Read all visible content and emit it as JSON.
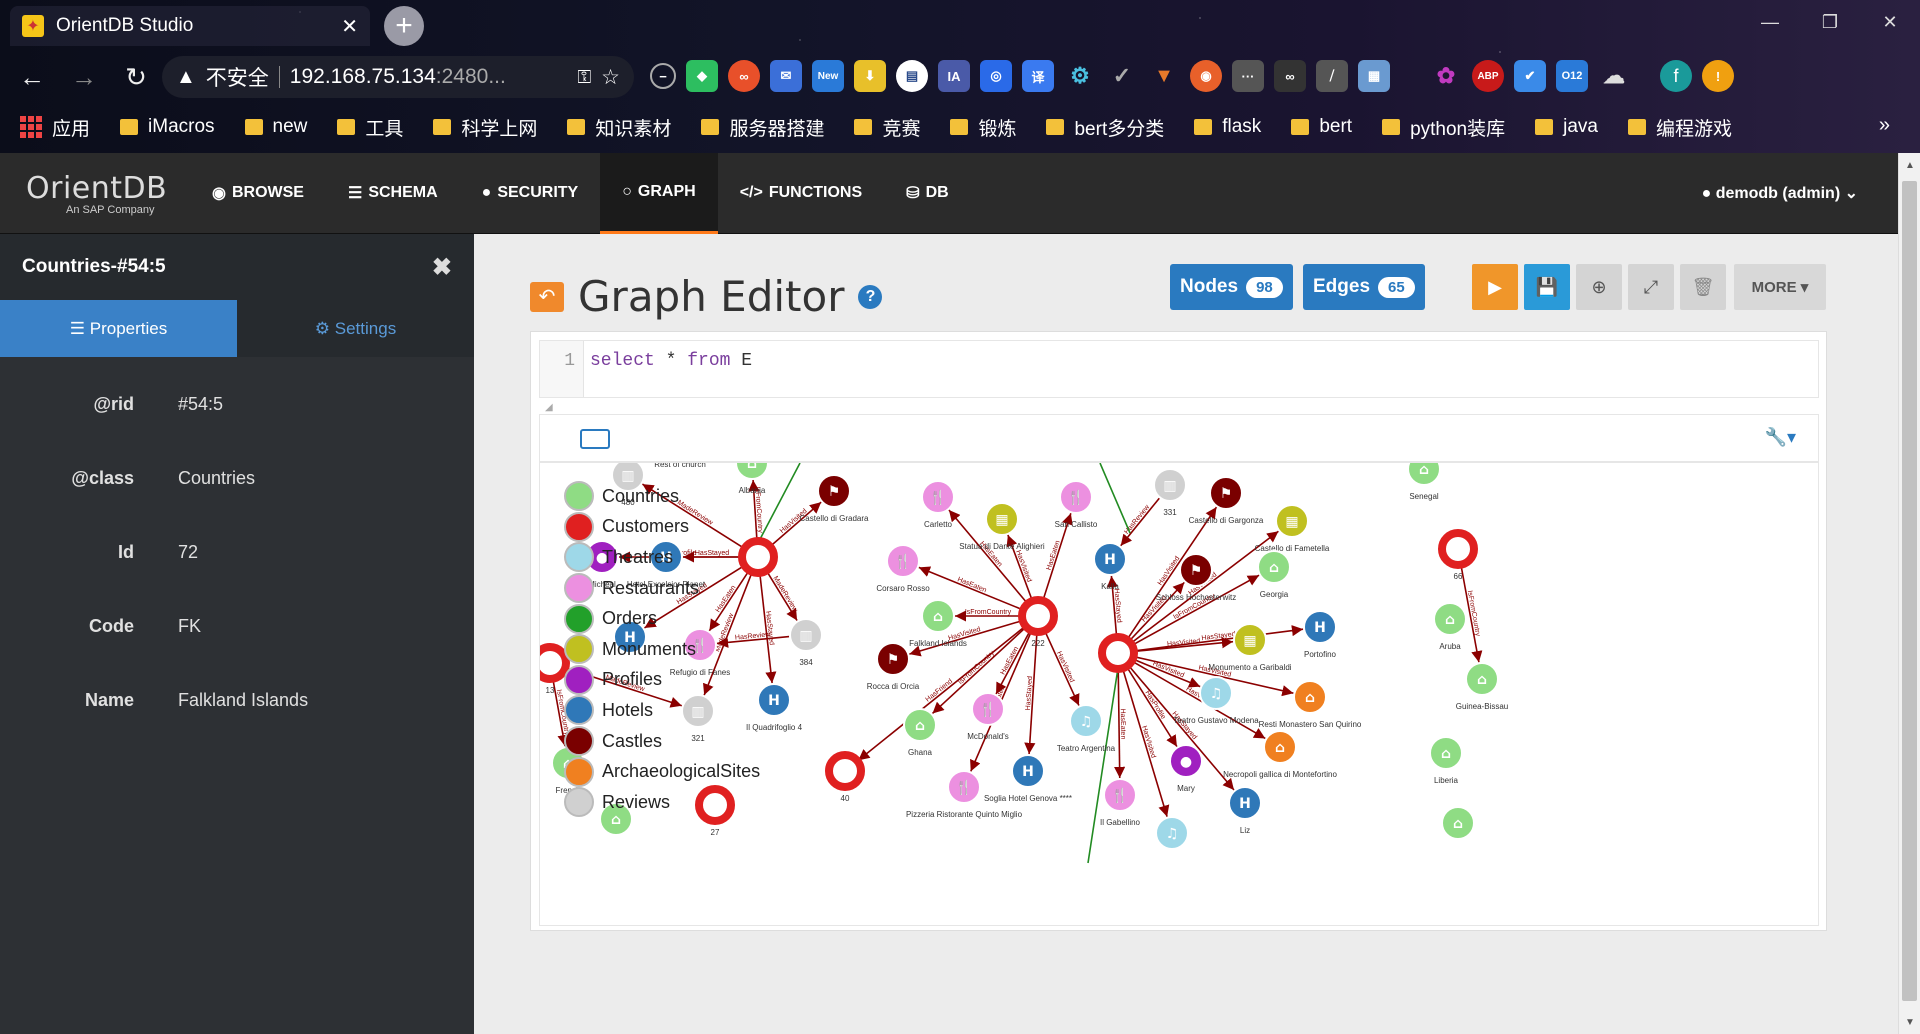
{
  "browser": {
    "tab_title": "OrientDB Studio",
    "address_warning": "不安全",
    "address_host": "192.168.75.134",
    "address_port": ":2480...",
    "extensions": [
      "minus-circle-icon",
      "evernote-icon",
      "infinity-icon",
      "mail-icon",
      "new-badge-icon",
      "pin-icon",
      "reader-icon",
      "ia-icon",
      "baidu-icon",
      "translate-icon",
      "gear-icon",
      "check-icon",
      "fox-icon",
      "target-icon",
      "dots-icon",
      "glasses-icon",
      "slash-icon",
      "image-icon",
      "candy-icon",
      "abp-icon",
      "check-badge-icon",
      "o12-icon",
      "cloud-icon",
      "profile-icon",
      "alert-icon"
    ],
    "ext_new_label": "New",
    "ext_ia_label": "IA",
    "ext_abp_label": "ABP",
    "ext_o12_label": "O12",
    "profile_letter": "f",
    "bookmarks": [
      "应用",
      "iMacros",
      "new",
      "工具",
      "科学上网",
      "知识素材",
      "服务器搭建",
      "竞赛",
      "锻炼",
      "bert多分类",
      "flask",
      "bert",
      "python装库",
      "java",
      "编程游戏"
    ]
  },
  "app": {
    "logo_name": "OrientDB",
    "logo_sub": "An SAP Company",
    "nav": [
      "BROWSE",
      "SCHEMA",
      "SECURITY",
      "GRAPH",
      "FUNCTIONS",
      "DB"
    ],
    "active_nav": "GRAPH",
    "user": "demodb (admin)"
  },
  "sidebar": {
    "title": "Countries-#54:5",
    "tab_properties": "Properties",
    "tab_settings": "Settings",
    "properties": [
      {
        "key": "@rid",
        "value": "#54:5"
      },
      {
        "key": "@class",
        "value": "Countries"
      },
      {
        "key": "Id",
        "value": "72"
      },
      {
        "key": "Code",
        "value": "FK"
      },
      {
        "key": "Name",
        "value": "Falkland Islands"
      }
    ]
  },
  "editor": {
    "title": "Graph Editor",
    "nodes_label": "Nodes",
    "nodes_count": "98",
    "edges_label": "Edges",
    "edges_count": "65",
    "more_label": "MORE",
    "line_number": "1",
    "query_kw1": "select",
    "query_star": "*",
    "query_kw2": "from",
    "query_cls": "E"
  },
  "legend": [
    {
      "label": "Countries",
      "color": "#8fdc84"
    },
    {
      "label": "Customers",
      "color": "#e02020"
    },
    {
      "label": "Theatres",
      "color": "#9ed8e8"
    },
    {
      "label": "Restaurants",
      "color": "#ec90e0"
    },
    {
      "label": "Orders",
      "color": "#22a02a"
    },
    {
      "label": "Monuments",
      "color": "#c0c020"
    },
    {
      "label": "Profiles",
      "color": "#a020c0"
    },
    {
      "label": "Hotels",
      "color": "#2f78b8"
    },
    {
      "label": "Castles",
      "color": "#7a0000"
    },
    {
      "label": "ArchaeologicalSites",
      "color": "#f08020"
    },
    {
      "label": "Reviews",
      "color": "#d0d0d0"
    }
  ],
  "graph_nodes": [
    {
      "id": "n1",
      "label": "",
      "cls": "Customers"
    },
    {
      "id": "n2",
      "label": "222",
      "cls": "Customers"
    },
    {
      "id": "n3",
      "label": "",
      "cls": "Customers"
    },
    {
      "id": "n4",
      "label": "66",
      "cls": "Customers"
    },
    {
      "id": "n5",
      "label": "40",
      "cls": "Customers"
    },
    {
      "id": "n6",
      "label": "27",
      "cls": "Customers"
    },
    {
      "id": "n7",
      "label": "13",
      "cls": "Customers"
    },
    {
      "id": "h1",
      "label": "Hotel Excelsior Planet",
      "cls": "Hotels"
    },
    {
      "id": "h2",
      "label": "Il Quadrifoglio 4",
      "cls": "Hotels"
    },
    {
      "id": "h3",
      "label": "Soglia Hotel Genova ****",
      "cls": "Hotels"
    },
    {
      "id": "h4",
      "label": "Kalla",
      "cls": "Hotels"
    },
    {
      "id": "h5",
      "label": "Portofino",
      "cls": "Hotels"
    },
    {
      "id": "h6",
      "label": "Liz",
      "cls": "Hotels"
    },
    {
      "id": "h7",
      "label": "",
      "cls": "Hotels"
    },
    {
      "id": "r1",
      "label": "Carletto",
      "cls": "Restaurants"
    },
    {
      "id": "r2",
      "label": "Corsaro Rosso",
      "cls": "Restaurants"
    },
    {
      "id": "r3",
      "label": "Refugio di Fanes",
      "cls": "Restaurants"
    },
    {
      "id": "r4",
      "label": "McDonald's",
      "cls": "Restaurants"
    },
    {
      "id": "r5",
      "label": "Pizzeria Ristorante Quinto Miglio",
      "cls": "Restaurants"
    },
    {
      "id": "r6",
      "label": "San Callisto",
      "cls": "Restaurants"
    },
    {
      "id": "r7",
      "label": "Il Gabellino",
      "cls": "Restaurants"
    },
    {
      "id": "c1",
      "label": "Castello di Gradara",
      "cls": "Castles"
    },
    {
      "id": "c2",
      "label": "Rocca di Orcia",
      "cls": "Castles"
    },
    {
      "id": "c3",
      "label": "Castello di Gargonza",
      "cls": "Castles"
    },
    {
      "id": "c4",
      "label": "Schloss Hochosterwitz",
      "cls": "Castles"
    },
    {
      "id": "m1",
      "label": "Statua di Dante Alighieri",
      "cls": "Monuments"
    },
    {
      "id": "m2",
      "label": "Castello di Fametella",
      "cls": "Monuments"
    },
    {
      "id": "m3",
      "label": "Monumento a Garibaldi",
      "cls": "Monuments"
    },
    {
      "id": "v1",
      "label": "480",
      "cls": "Reviews"
    },
    {
      "id": "v2",
      "label": "384",
      "cls": "Reviews"
    },
    {
      "id": "v3",
      "label": "321",
      "cls": "Reviews"
    },
    {
      "id": "v4",
      "label": "331",
      "cls": "Reviews"
    },
    {
      "id": "co1",
      "label": "Falkland Islands",
      "cls": "Countries"
    },
    {
      "id": "co2",
      "label": "Ghana",
      "cls": "Countries"
    },
    {
      "id": "co3",
      "label": "Georgia",
      "cls": "Countries"
    },
    {
      "id": "co4",
      "label": "Senegal",
      "cls": "Countries"
    },
    {
      "id": "co5",
      "label": "Aruba",
      "cls": "Countries"
    },
    {
      "id": "co6",
      "label": "Guinea-Bissau",
      "cls": "Countries"
    },
    {
      "id": "co7",
      "label": "Liberia",
      "cls": "Countries"
    },
    {
      "id": "co8",
      "label": "French",
      "cls": "Countries"
    },
    {
      "id": "co9",
      "label": "Albania",
      "cls": "Countries"
    },
    {
      "id": "co10",
      "label": "",
      "cls": "Countries"
    },
    {
      "id": "co11",
      "label": "",
      "cls": "Countries"
    },
    {
      "id": "t1",
      "label": "Teatro Argentina",
      "cls": "Theatres"
    },
    {
      "id": "t2",
      "label": "Teatro Gustavo Modena",
      "cls": "Theatres"
    },
    {
      "id": "t3",
      "label": "",
      "cls": "Theatres"
    },
    {
      "id": "a1",
      "label": "Resti Monastero San Quirino",
      "cls": "ArchaeologicalSites"
    },
    {
      "id": "a2",
      "label": "Necropoli gallica di Montefortino",
      "cls": "ArchaeologicalSites"
    },
    {
      "id": "p1",
      "label": "Micheal",
      "cls": "Profiles"
    },
    {
      "id": "p2",
      "label": "Mary",
      "cls": "Profiles"
    },
    {
      "id": "x1",
      "label": "Rest of church",
      "cls": "Other"
    }
  ],
  "graph_edges": [
    {
      "from": "n1",
      "to": "c1",
      "label": "HasVisited"
    },
    {
      "from": "n1",
      "to": "h1",
      "label": "HasStayed"
    },
    {
      "from": "n1",
      "to": "v1",
      "label": "MadeReview"
    },
    {
      "from": "n1",
      "to": "r3",
      "label": "HasEaten"
    },
    {
      "from": "n1",
      "to": "h2",
      "label": "HasStayed"
    },
    {
      "from": "n1",
      "to": "v2",
      "label": "MadeReview"
    },
    {
      "from": "n1",
      "to": "h7",
      "label": "HasStayed"
    },
    {
      "from": "n1",
      "to": "p1",
      "label": "HasProfile"
    },
    {
      "from": "n1",
      "to": "co9",
      "label": "IsFromCountry"
    },
    {
      "from": "n1",
      "to": "v3",
      "label": "MadeReview"
    },
    {
      "from": "n2",
      "to": "r1",
      "label": "HasEaten"
    },
    {
      "from": "n2",
      "to": "m1",
      "label": "HasVisited"
    },
    {
      "from": "n2",
      "to": "r6",
      "label": "HasEaten"
    },
    {
      "from": "n2",
      "to": "r2",
      "label": "HasEaten"
    },
    {
      "from": "n2",
      "to": "co1",
      "label": "IsFromCountry"
    },
    {
      "from": "n2",
      "to": "c2",
      "label": "HasVisited"
    },
    {
      "from": "n2",
      "to": "r4",
      "label": "HasEaten"
    },
    {
      "from": "n2",
      "to": "h3",
      "label": "HasStayed"
    },
    {
      "from": "n2",
      "to": "t1",
      "label": "HasVisited"
    },
    {
      "from": "n2",
      "to": "r5",
      "label": "HasEaten"
    },
    {
      "from": "n2",
      "to": "co2",
      "label": "IsFromCountry"
    },
    {
      "from": "n2",
      "to": "n5",
      "label": "HasFriend"
    },
    {
      "from": "n3",
      "to": "h4",
      "label": "HasStayed"
    },
    {
      "from": "n3",
      "to": "c3",
      "label": "HasVisited"
    },
    {
      "from": "n3",
      "to": "m2",
      "label": "HasVisited"
    },
    {
      "from": "n3",
      "to": "c4",
      "label": "HasVisited"
    },
    {
      "from": "n3",
      "to": "co3",
      "label": "IsFromCountry"
    },
    {
      "from": "n3",
      "to": "m3",
      "label": "HasVisited"
    },
    {
      "from": "n3",
      "to": "h5",
      "label": "HasStayed"
    },
    {
      "from": "n3",
      "to": "t2",
      "label": "HasVisited"
    },
    {
      "from": "n3",
      "to": "a1",
      "label": "HasVisited"
    },
    {
      "from": "n3",
      "to": "a2",
      "label": "HasVisited"
    },
    {
      "from": "n3",
      "to": "p2",
      "label": "HasProfile"
    },
    {
      "from": "n3",
      "to": "h6",
      "label": "HasStayed"
    },
    {
      "from": "n3",
      "to": "r7",
      "label": "HasEaten"
    },
    {
      "from": "n3",
      "to": "t3",
      "label": "HasVisited"
    },
    {
      "from": "n4",
      "to": "co6",
      "label": "IsFromCountry"
    },
    {
      "from": "v4",
      "to": "h4",
      "label": "HasReview"
    },
    {
      "from": "v2",
      "to": "r3",
      "label": "HasReview"
    },
    {
      "from": "n7",
      "to": "co8",
      "label": "IsFromCountry"
    },
    {
      "from": "n7",
      "to": "v3",
      "label": "MadeReview"
    }
  ],
  "colors": {
    "accent": "#ff7a1a",
    "primary": "#2a7ac0",
    "sidebar_bg": "#2d3034",
    "edge": "#8b0000",
    "edge_green": "#228b22"
  }
}
